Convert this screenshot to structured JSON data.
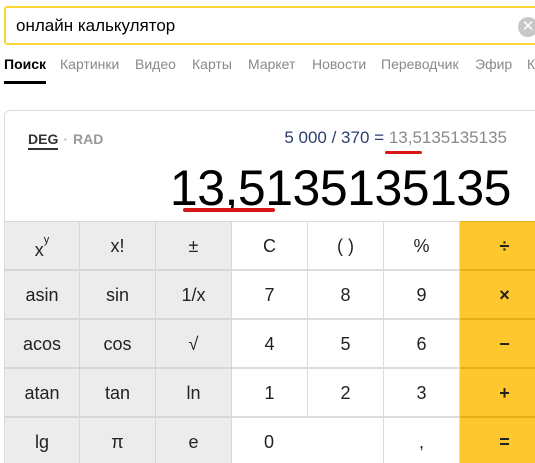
{
  "search": {
    "query": "онлайн калькулятор",
    "clear_icon": "close-icon"
  },
  "tabs": [
    {
      "label": "Поиск",
      "active": true
    },
    {
      "label": "Картинки"
    },
    {
      "label": "Видео"
    },
    {
      "label": "Карты"
    },
    {
      "label": "Маркет"
    },
    {
      "label": "Новости"
    },
    {
      "label": "Переводчик"
    },
    {
      "label": "Эфир"
    },
    {
      "label": "К"
    }
  ],
  "calculator": {
    "mode_deg": "DEG",
    "mode_sep": "·",
    "mode_rad": "RAD",
    "expression": "5 000 / 370 =",
    "expression_result": "13,5135135135",
    "result": "13,5135135135",
    "highlight_color": "#d81616",
    "accent_color": "#fec72e",
    "keys": {
      "power_base": "x",
      "power_exp": "y",
      "factorial": "x!",
      "plusminus": "±",
      "clear": "C",
      "parens": "( )",
      "percent": "%",
      "divide": "÷",
      "asin": "asin",
      "sin": "sin",
      "reciprocal": "1/x",
      "d7": "7",
      "d8": "8",
      "d9": "9",
      "multiply": "×",
      "acos": "acos",
      "cos": "cos",
      "sqrt": "√",
      "d4": "4",
      "d5": "5",
      "d6": "6",
      "minus": "−",
      "atan": "atan",
      "tan": "tan",
      "ln": "ln",
      "d1": "1",
      "d2": "2",
      "d3": "3",
      "plus": "+",
      "lg": "lg",
      "pi": "π",
      "e": "e",
      "d0": "0",
      "comma": ",",
      "equals": "="
    }
  }
}
